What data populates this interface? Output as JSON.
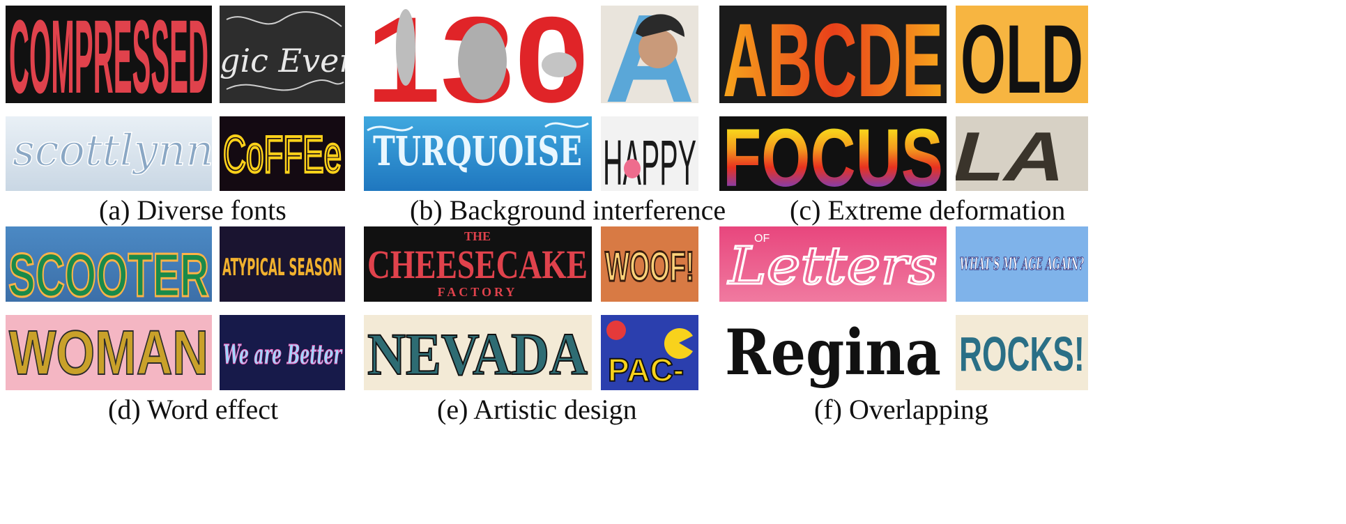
{
  "panels": [
    {
      "caption": "(a) Diverse fonts",
      "tiles": [
        "COMPRESSED",
        "gic Every D",
        "scottlynn",
        "CoFFEe",
        "",
        "",
        "",
        ""
      ]
    },
    {
      "caption": "(b) Background interference",
      "tiles": [
        "130",
        "A",
        "TURQUOISE",
        "HAPPY"
      ]
    },
    {
      "caption": "(c) Extreme deformation",
      "tiles": [
        "ABCDE",
        "OLD",
        "FOCUS",
        "LA"
      ]
    },
    {
      "caption": "(d) Word effect",
      "tiles": [
        "SCOOTER",
        "ATYPICAL SEASON",
        "WOMAN",
        "We are Better"
      ]
    },
    {
      "caption": "(e) Artistic design",
      "tiles": [
        "THE",
        "CHEESECAKE",
        "FACTORY",
        "WOOF!",
        "NEVADA",
        "PAC-"
      ]
    },
    {
      "caption": "(f) Overlapping",
      "tiles": [
        "OF",
        "Letters",
        "WHAT'S MY AGE AGAIN?",
        "Regina",
        "ROCKS!"
      ]
    }
  ],
  "colors": {
    "red": "#e02428",
    "black": "#111111",
    "yellow": "#f5c518",
    "orange": "#f39a1e",
    "blue": "#2e9ad6",
    "pink": "#e8467d",
    "cream": "#f3ead6"
  }
}
